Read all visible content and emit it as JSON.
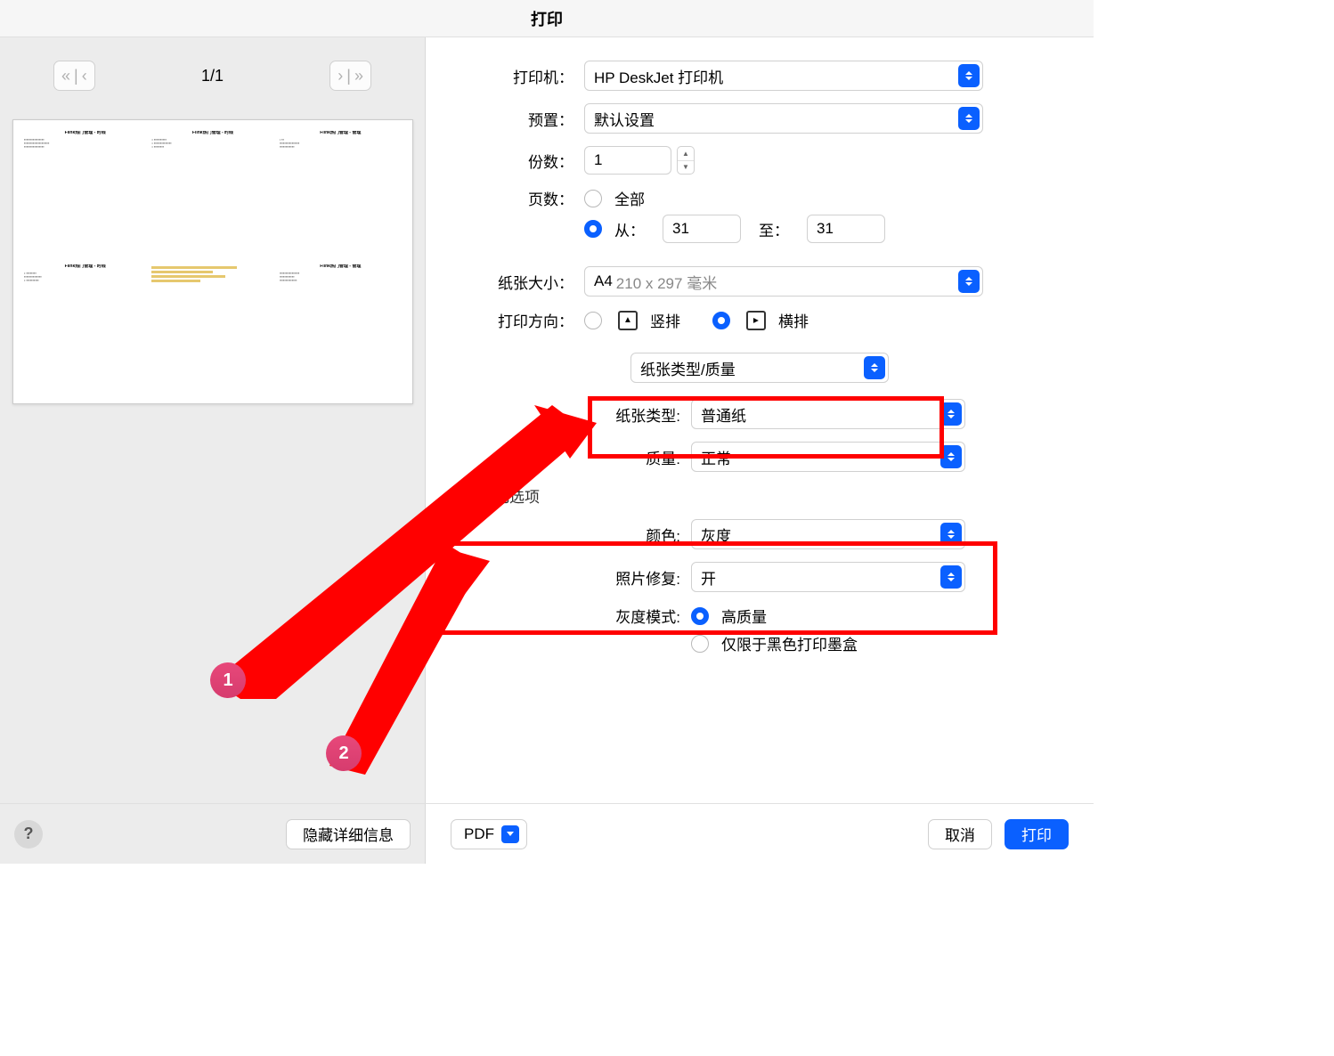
{
  "title": "打印",
  "preview": {
    "page_indicator": "1/1",
    "slides": [
      "Flink热门管理 - 时线",
      "Flink热门管理 - 时线",
      "Flink热门管理 - 管理",
      "Flink热门管理 - 时线",
      "",
      "Flink热门管理 - 管理"
    ]
  },
  "labels": {
    "printer": "打印机：",
    "preset": "预置：",
    "copies": "份数：",
    "pages": "页数：",
    "all": "全部",
    "from": "从：",
    "to": "至：",
    "paper_size": "纸张大小：",
    "orientation": "打印方向：",
    "portrait": "竖排",
    "landscape": "横排",
    "paper_type": "纸张类型:",
    "quality": "质量:",
    "color_section": "颜色选项",
    "color": "颜色:",
    "photo_fix": "照片修复:",
    "gray_mode": "灰度模式:",
    "gray_high": "高质量",
    "gray_black_only": "仅限于黑色打印墨盒"
  },
  "values": {
    "printer": "HP DeskJet 打印机",
    "preset": "默认设置",
    "copies": "1",
    "from_page": "31",
    "to_page": "31",
    "paper_size_main": "A4",
    "paper_size_sub": "210 x 297 毫米",
    "section_dropdown": "纸张类型/质量",
    "paper_type": "普通纸",
    "quality": "正常",
    "color": "灰度",
    "photo_fix": "开"
  },
  "buttons": {
    "hide_details": "隐藏详细信息",
    "pdf": "PDF",
    "cancel": "取消",
    "print": "打印",
    "help": "?"
  },
  "annotations": {
    "callout1": "1",
    "callout2": "2"
  }
}
